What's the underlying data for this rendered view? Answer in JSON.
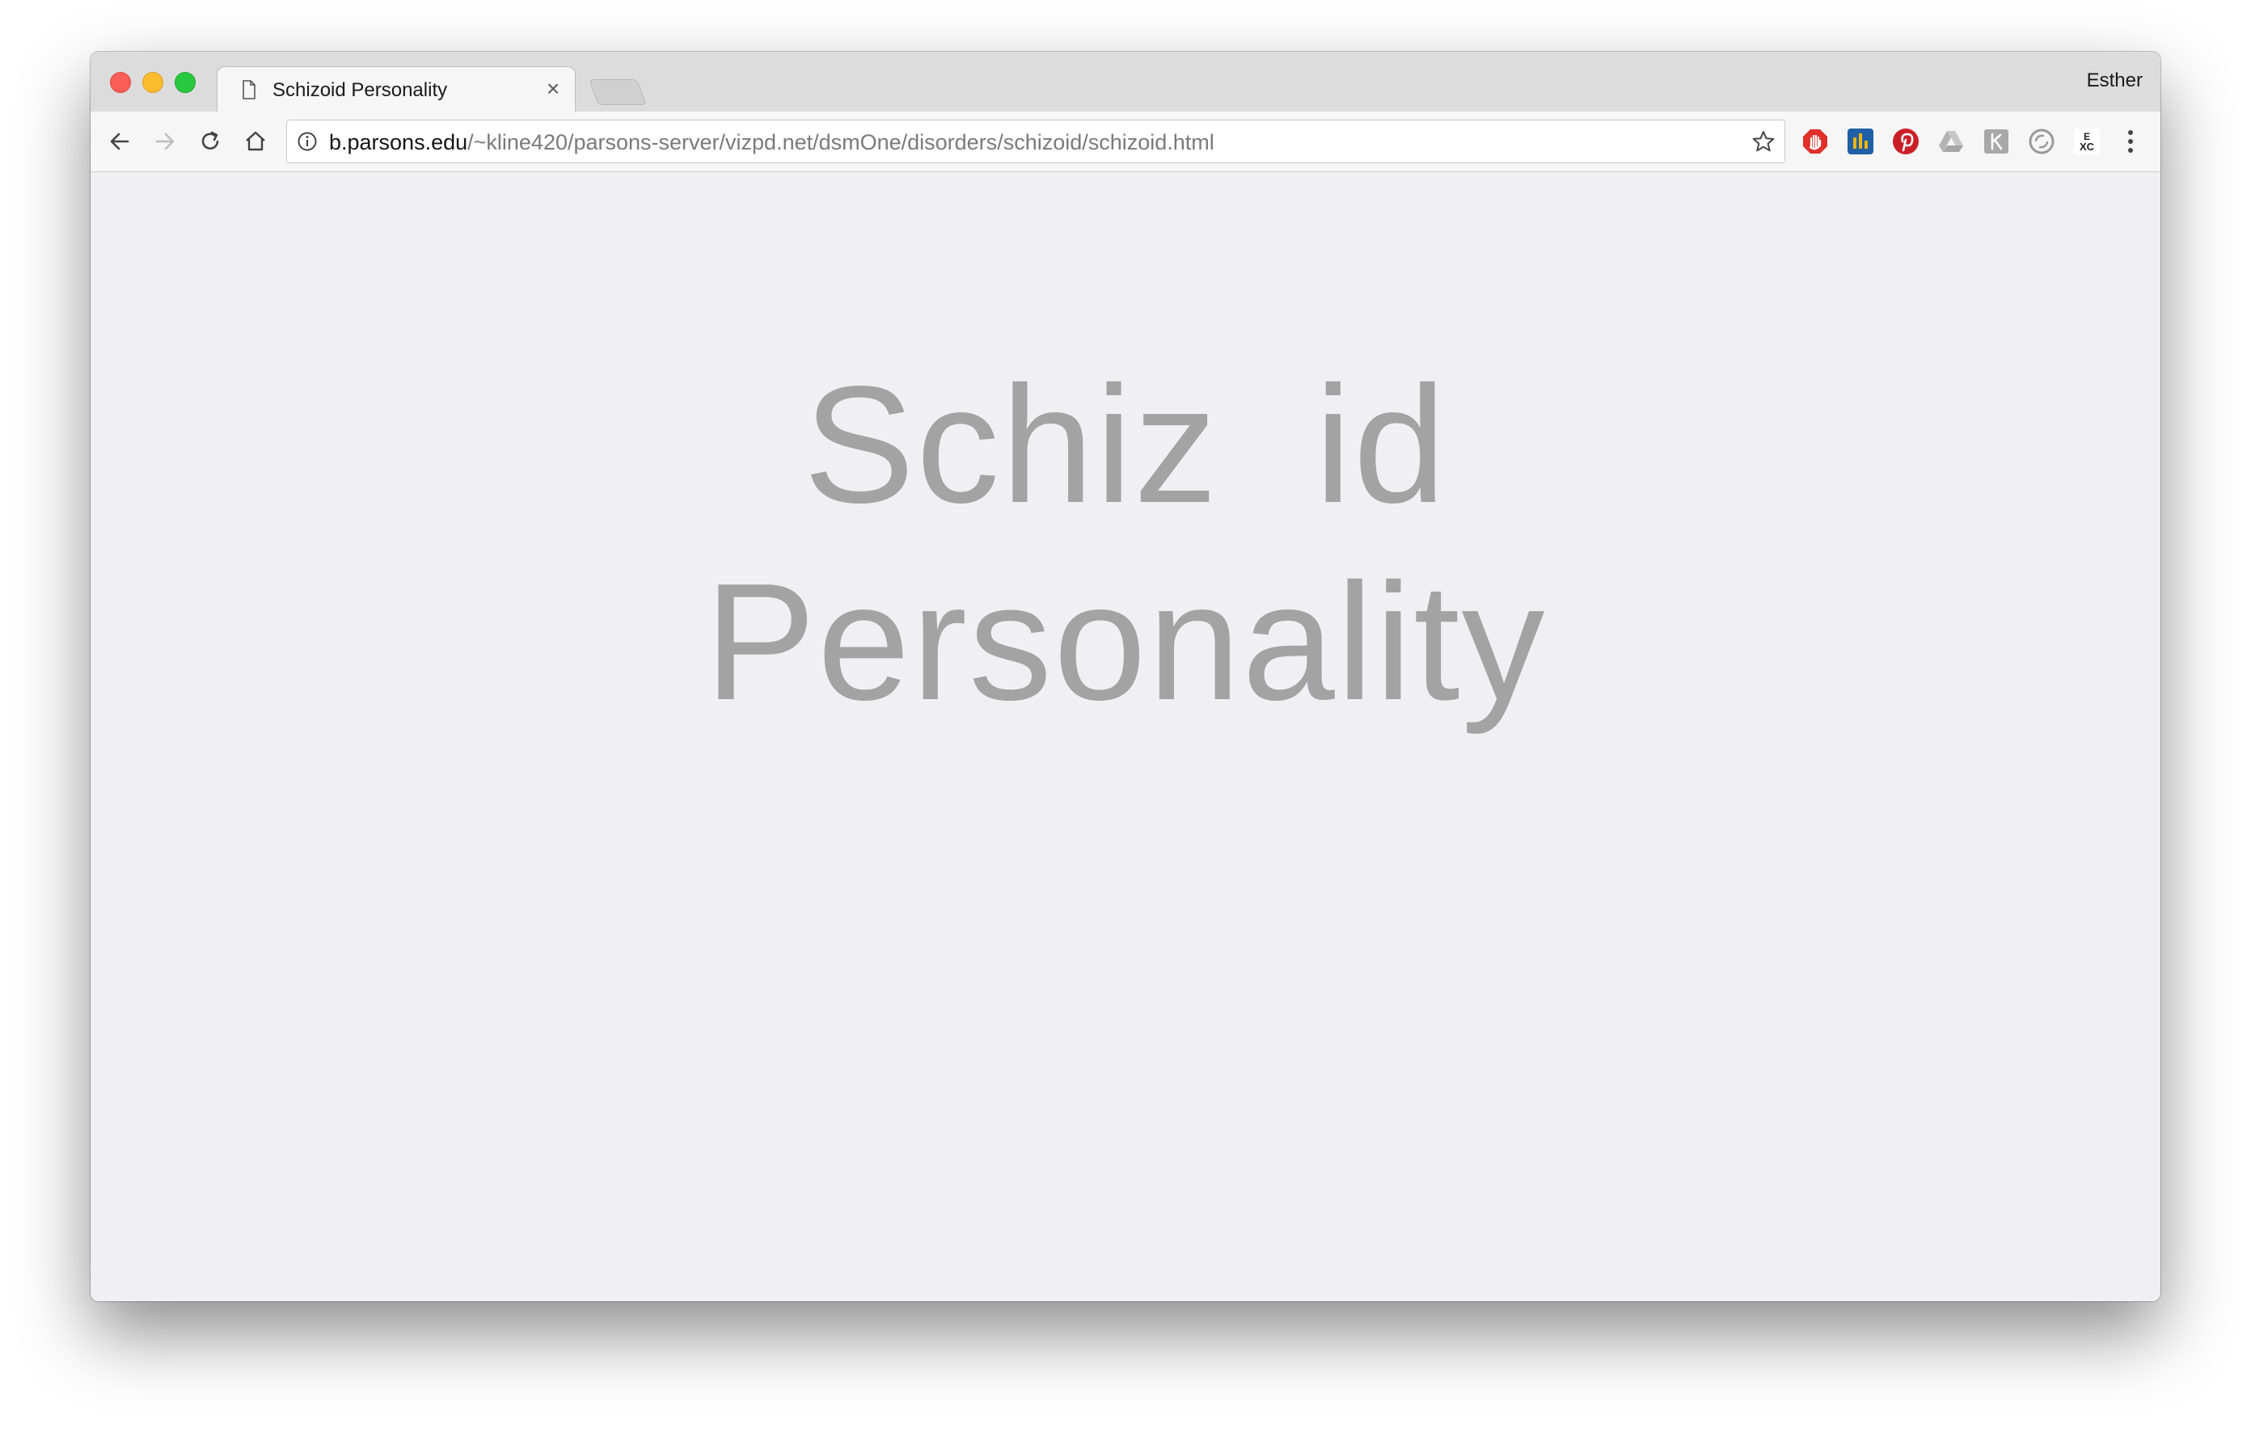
{
  "window": {
    "profile_name": "Esther"
  },
  "tab": {
    "title": "Schizoid Personality",
    "close_glyph": "×"
  },
  "toolbar": {
    "url_host": "b.parsons.edu",
    "url_path": "/~kline420/parsons-server/vizpd.net/dsmOne/disorders/schizoid/schizoid.html"
  },
  "extensions": [
    {
      "name": "adblock-icon",
      "color": "#e0302a"
    },
    {
      "name": "stats-icon",
      "color": "#1f5fa6"
    },
    {
      "name": "pinterest-icon",
      "color": "#cb1f27"
    },
    {
      "name": "drive-icon",
      "color": "#b8b8b8"
    },
    {
      "name": "extension-k-icon",
      "color": "#a8a8a8"
    },
    {
      "name": "sync-icon",
      "color": "#9a9a9a"
    },
    {
      "name": "fxc-icon",
      "color": "#222222"
    }
  ],
  "page": {
    "heading_line1": "Schiz  id",
    "heading_line2": "Personality"
  }
}
